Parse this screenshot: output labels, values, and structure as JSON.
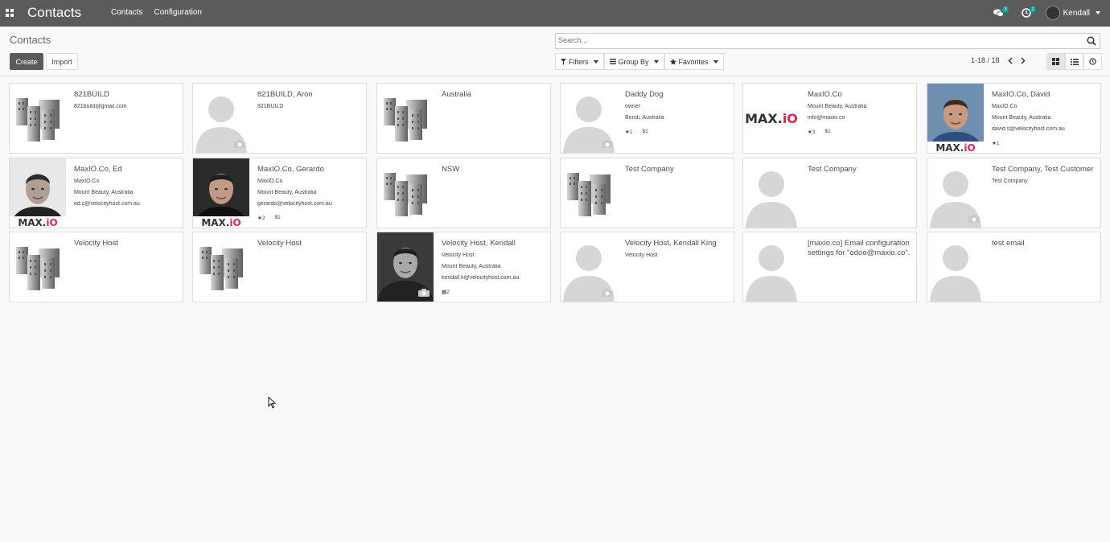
{
  "navbar": {
    "brand": "Contacts",
    "menu": [
      "Contacts",
      "Configuration"
    ],
    "messages_count": "3",
    "activities_count": "2",
    "user": "Kendall"
  },
  "control_panel": {
    "title": "Contacts",
    "create_label": "Create",
    "import_label": "Import",
    "search_placeholder": "Search...",
    "filters_label": "Filters",
    "groupby_label": "Group By",
    "favorites_label": "Favorites",
    "pager": "1-18 / 18"
  },
  "cards": [
    {
      "name": "821BUILD",
      "lines": [
        "821build@gmail.com"
      ],
      "img": "company"
    },
    {
      "name": "821BUILD, Aron",
      "lines": [
        "821BUILD"
      ],
      "img": "person"
    },
    {
      "name": "Australia",
      "lines": [],
      "img": "company"
    },
    {
      "name": "Daddy Dog",
      "lines": [
        "owner",
        "Bondi, Australia"
      ],
      "img": "person",
      "meta": [
        "★1",
        "$1"
      ]
    },
    {
      "name": "MaxIO.Co",
      "lines": [
        "Mount Beauty, Australia",
        "info@maxio.co"
      ],
      "img": "maxio-logo",
      "logo": "MAX.iO",
      "meta": [
        "★3",
        "$1"
      ]
    },
    {
      "name": "MaxIO.Co, David",
      "lines": [
        "MaxIO.Co",
        "Mount Beauty, Australia",
        "david.s@velocityhost.com.au"
      ],
      "img": "photo-david",
      "logo": "MAX.iO",
      "meta": [
        "★1"
      ]
    },
    {
      "name": "MaxIO.Co, Ed",
      "lines": [
        "MaxIO.Co",
        "Mount Beauty, Australia",
        "ed.c@velocityhost.com.au"
      ],
      "img": "photo-ed",
      "logo": "MAX.iO"
    },
    {
      "name": "MaxIO.Co, Gerardo",
      "lines": [
        "MaxIO.Co",
        "Mount Beauty, Australia",
        "gerardo@velocityhost.com.au"
      ],
      "img": "photo-gerardo",
      "logo": "MAX.iO",
      "meta": [
        "★2",
        "$1"
      ]
    },
    {
      "name": "NSW",
      "lines": [],
      "img": "company"
    },
    {
      "name": "Test Company",
      "lines": [],
      "img": "company"
    },
    {
      "name": "Test Company",
      "lines": [],
      "img": "person-nocam"
    },
    {
      "name": "Test Company, Test Customer",
      "lines": [
        "Test Company"
      ],
      "img": "person"
    },
    {
      "name": "Velocity Host",
      "lines": [],
      "img": "company"
    },
    {
      "name": "Velocity Host",
      "lines": [],
      "img": "company"
    },
    {
      "name": "Velocity Host, Kendall",
      "lines": [
        "Velocity Host",
        "Mount Beauty, Australia",
        "kendall.k@velocityhost.com.au"
      ],
      "img": "photo-kendall",
      "meta": [
        "▦2"
      ]
    },
    {
      "name": "Velocity Host, Kendall King",
      "lines": [
        "Velocity Host"
      ],
      "img": "person"
    },
    {
      "name": "[maxio.co] Email configuration settings for \"odoo@maxio.co\".",
      "lines": [],
      "img": "person-nocam"
    },
    {
      "name": "test email",
      "lines": [],
      "img": "person-nocam"
    }
  ]
}
